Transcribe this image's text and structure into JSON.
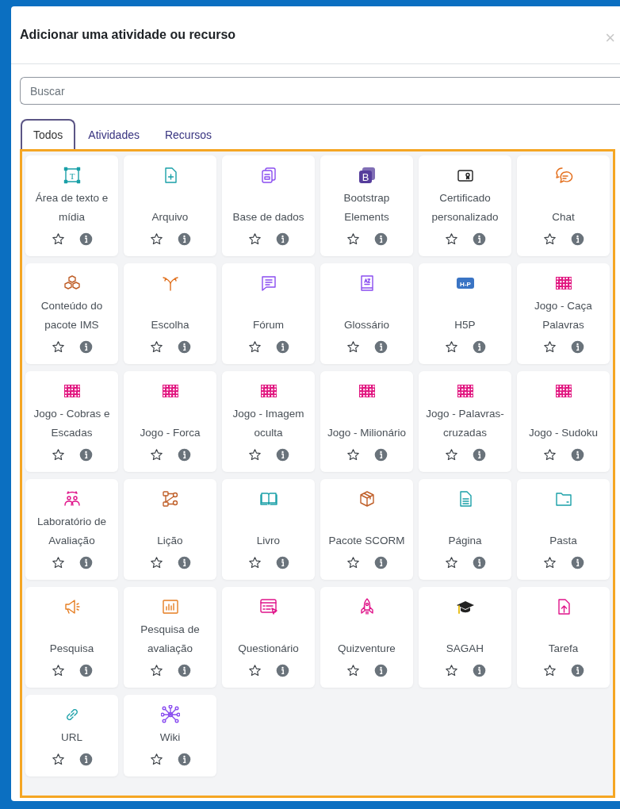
{
  "dialog": {
    "title": "Adicionar uma atividade ou recurso",
    "close": "×"
  },
  "search": {
    "placeholder": "Buscar"
  },
  "tabs": [
    {
      "label": "Todos",
      "selected": true
    },
    {
      "label": "Atividades",
      "selected": false
    },
    {
      "label": "Recursos",
      "selected": false
    }
  ],
  "items": [
    {
      "label": "Área de texto e mídia",
      "kind": "textarea",
      "icon_text": "T",
      "starred": false
    },
    {
      "label": "Arquivo",
      "kind": "fileplus",
      "starred": false
    },
    {
      "label": "Base de dados",
      "kind": "database",
      "starred": false
    },
    {
      "label": "Bootstrap Elements",
      "kind": "bootstrap",
      "icon_text": "B",
      "starred": false
    },
    {
      "label": "Certificado personalizado",
      "kind": "certificate",
      "starred": false
    },
    {
      "label": "Chat",
      "kind": "chat",
      "starred": false
    },
    {
      "label": "Conteúdo do pacote IMS",
      "kind": "cubes",
      "starred": false
    },
    {
      "label": "Escolha",
      "kind": "fork",
      "starred": false
    },
    {
      "label": "Fórum",
      "kind": "forum",
      "starred": false
    },
    {
      "label": "Glossário",
      "kind": "glossary",
      "starred": false
    },
    {
      "label": "H5P",
      "kind": "h5p",
      "icon_text": "H-P",
      "starred": false
    },
    {
      "label": "Jogo - Caça Palavras",
      "kind": "game",
      "starred": false
    },
    {
      "label": "Jogo - Cobras e Escadas",
      "kind": "game",
      "starred": false
    },
    {
      "label": "Jogo - Forca",
      "kind": "game",
      "starred": false
    },
    {
      "label": "Jogo - Imagem oculta",
      "kind": "game",
      "starred": false
    },
    {
      "label": "Jogo - Milionário",
      "kind": "game",
      "starred": false
    },
    {
      "label": "Jogo - Palavras-cruzadas",
      "kind": "game",
      "starred": false
    },
    {
      "label": "Jogo - Sudoku",
      "kind": "game",
      "starred": false
    },
    {
      "label": "Laboratório de Avaliação",
      "kind": "people",
      "starred": false
    },
    {
      "label": "Lição",
      "kind": "nodes",
      "starred": false
    },
    {
      "label": "Livro",
      "kind": "book",
      "starred": false
    },
    {
      "label": "Pacote SCORM",
      "kind": "package",
      "starred": false
    },
    {
      "label": "Página",
      "kind": "page",
      "starred": false
    },
    {
      "label": "Pasta",
      "kind": "folder",
      "starred": false
    },
    {
      "label": "Pesquisa",
      "kind": "megaphone",
      "starred": false
    },
    {
      "label": "Pesquisa de avaliação",
      "kind": "chart",
      "starred": false
    },
    {
      "label": "Questionário",
      "kind": "quiz",
      "starred": false
    },
    {
      "label": "Quizventure",
      "kind": "rocket",
      "starred": false
    },
    {
      "label": "SAGAH",
      "kind": "cap",
      "starred": false
    },
    {
      "label": "Tarefa",
      "kind": "upload",
      "starred": false
    },
    {
      "label": "URL",
      "kind": "link",
      "starred": false
    },
    {
      "label": "Wiki",
      "kind": "network",
      "starred": false
    }
  ]
}
